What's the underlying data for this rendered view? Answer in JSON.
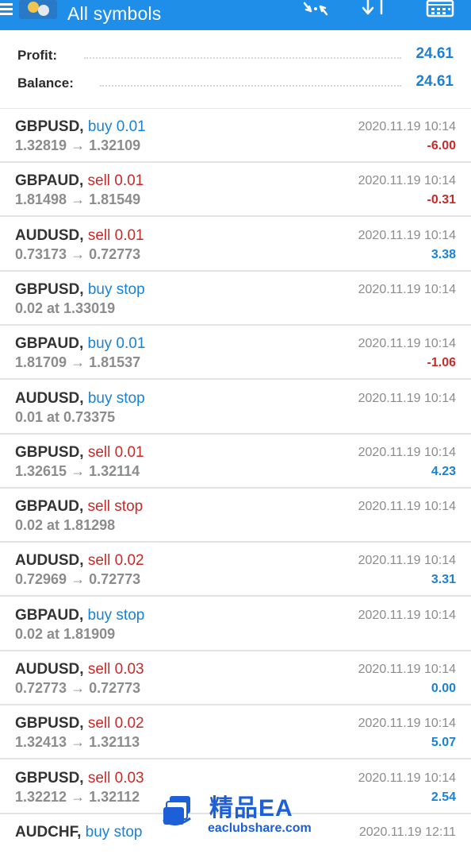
{
  "header": {
    "title": "All symbols",
    "icons": [
      "menu-icon",
      "app-logo",
      "sort-direction-icon",
      "sort-icon",
      "calendar-icon"
    ],
    "accent_color": "#1f8ee8"
  },
  "summary": {
    "profit_label": "Profit:",
    "profit_value": "24.61",
    "balance_label": "Balance:",
    "balance_value": "24.61"
  },
  "trades": [
    {
      "symbol": "GBPUSD",
      "type": "buy 0.01",
      "side": "buy",
      "prices": "1.32819 → 1.32109",
      "time": "2020.11.19 10:14",
      "profit": "-6.00"
    },
    {
      "symbol": "GBPAUD",
      "type": "sell 0.01",
      "side": "sell",
      "prices": "1.81498 → 1.81549",
      "time": "2020.11.19 10:14",
      "profit": "-0.31"
    },
    {
      "symbol": "AUDUSD",
      "type": "sell 0.01",
      "side": "sell",
      "prices": "0.73173 → 0.72773",
      "time": "2020.11.19 10:14",
      "profit": "3.38"
    },
    {
      "symbol": "GBPUSD",
      "type": "buy stop",
      "side": "buy",
      "prices": "0.02 at 1.33019",
      "time": "2020.11.19 10:14",
      "profit": ""
    },
    {
      "symbol": "GBPAUD",
      "type": "buy 0.01",
      "side": "buy",
      "prices": "1.81709 → 1.81537",
      "time": "2020.11.19 10:14",
      "profit": "-1.06"
    },
    {
      "symbol": "AUDUSD",
      "type": "buy stop",
      "side": "buy",
      "prices": "0.01 at 0.73375",
      "time": "2020.11.19 10:14",
      "profit": ""
    },
    {
      "symbol": "GBPUSD",
      "type": "sell 0.01",
      "side": "sell",
      "prices": "1.32615 → 1.32114",
      "time": "2020.11.19 10:14",
      "profit": "4.23"
    },
    {
      "symbol": "GBPAUD",
      "type": "sell stop",
      "side": "sell",
      "prices": "0.02 at 1.81298",
      "time": "2020.11.19 10:14",
      "profit": ""
    },
    {
      "symbol": "AUDUSD",
      "type": "sell 0.02",
      "side": "sell",
      "prices": "0.72969 → 0.72773",
      "time": "2020.11.19 10:14",
      "profit": "3.31"
    },
    {
      "symbol": "GBPAUD",
      "type": "buy stop",
      "side": "buy",
      "prices": "0.02 at 1.81909",
      "time": "2020.11.19 10:14",
      "profit": ""
    },
    {
      "symbol": "AUDUSD",
      "type": "sell 0.03",
      "side": "sell",
      "prices": "0.72773 → 0.72773",
      "time": "2020.11.19 10:14",
      "profit": "0.00"
    },
    {
      "symbol": "GBPUSD",
      "type": "sell 0.02",
      "side": "sell",
      "prices": "1.32413 → 1.32113",
      "time": "2020.11.19 10:14",
      "profit": "5.07"
    },
    {
      "symbol": "GBPUSD",
      "type": "sell 0.03",
      "side": "sell",
      "prices": "1.32212 → 1.32112",
      "time": "2020.11.19 10:14",
      "profit": "2.54"
    },
    {
      "symbol": "AUDCHF",
      "type": "buy stop",
      "side": "buy",
      "prices": "",
      "time": "2020.11.19 12:11",
      "profit": ""
    }
  ],
  "watermark": {
    "title": "精品EA",
    "subtitle": "eaclubshare.com"
  },
  "colors": {
    "buy": "#1a82d4",
    "sell": "#c92a2a",
    "value": "#1f7fd0"
  }
}
